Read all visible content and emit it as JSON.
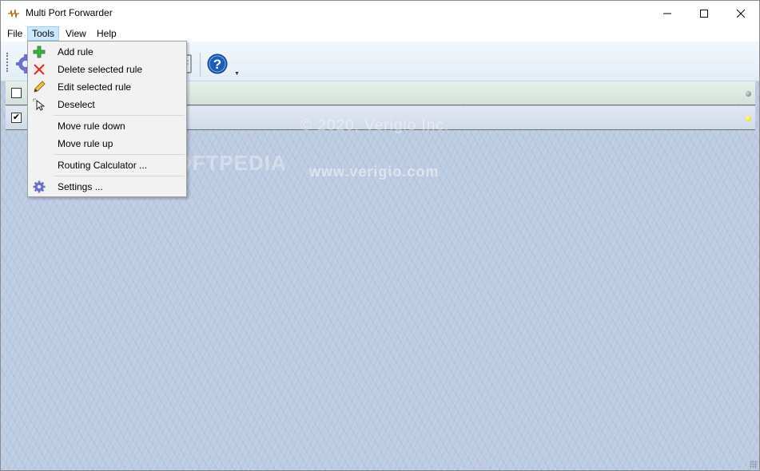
{
  "window": {
    "title": "Multi Port Forwarder"
  },
  "caption_buttons": {
    "minimize": "minimize-icon",
    "maximize": "maximize-icon",
    "close": "close-icon"
  },
  "menubar": {
    "file": "File",
    "tools": "Tools",
    "view": "View",
    "help": "Help"
  },
  "toolbar": {
    "icons": [
      "settings-icon",
      "clipboard-icon",
      "help-icon"
    ]
  },
  "tools_menu": {
    "items": [
      {
        "label": "Add rule",
        "icon": "add-icon"
      },
      {
        "label": "Delete selected rule",
        "icon": "delete-icon"
      },
      {
        "label": "Edit selected rule",
        "icon": "edit-pencil-icon"
      },
      {
        "label": "Deselect",
        "icon": "deselect-cursor-icon"
      },
      {
        "label": "Move rule down",
        "icon": ""
      },
      {
        "label": "Move rule up",
        "icon": ""
      },
      {
        "label": "Routing Calculator ...",
        "icon": ""
      },
      {
        "label": "Settings ...",
        "icon": "settings-gear-icon"
      }
    ]
  },
  "rules": [
    {
      "checked": false,
      "status_color": "#8c8c8c"
    },
    {
      "checked": true,
      "check_glyph": "✔",
      "status_color": "#e6e600"
    }
  ],
  "watermarks": {
    "copyright": "© 2020, Verigio Inc.",
    "url": "www.verigio.com",
    "softpedia": "SOFTPEDIA"
  },
  "colors": {
    "menu_highlight": "#cce8ff",
    "content_background": "#bccbe2",
    "help_blue": "#1a5fb4"
  }
}
